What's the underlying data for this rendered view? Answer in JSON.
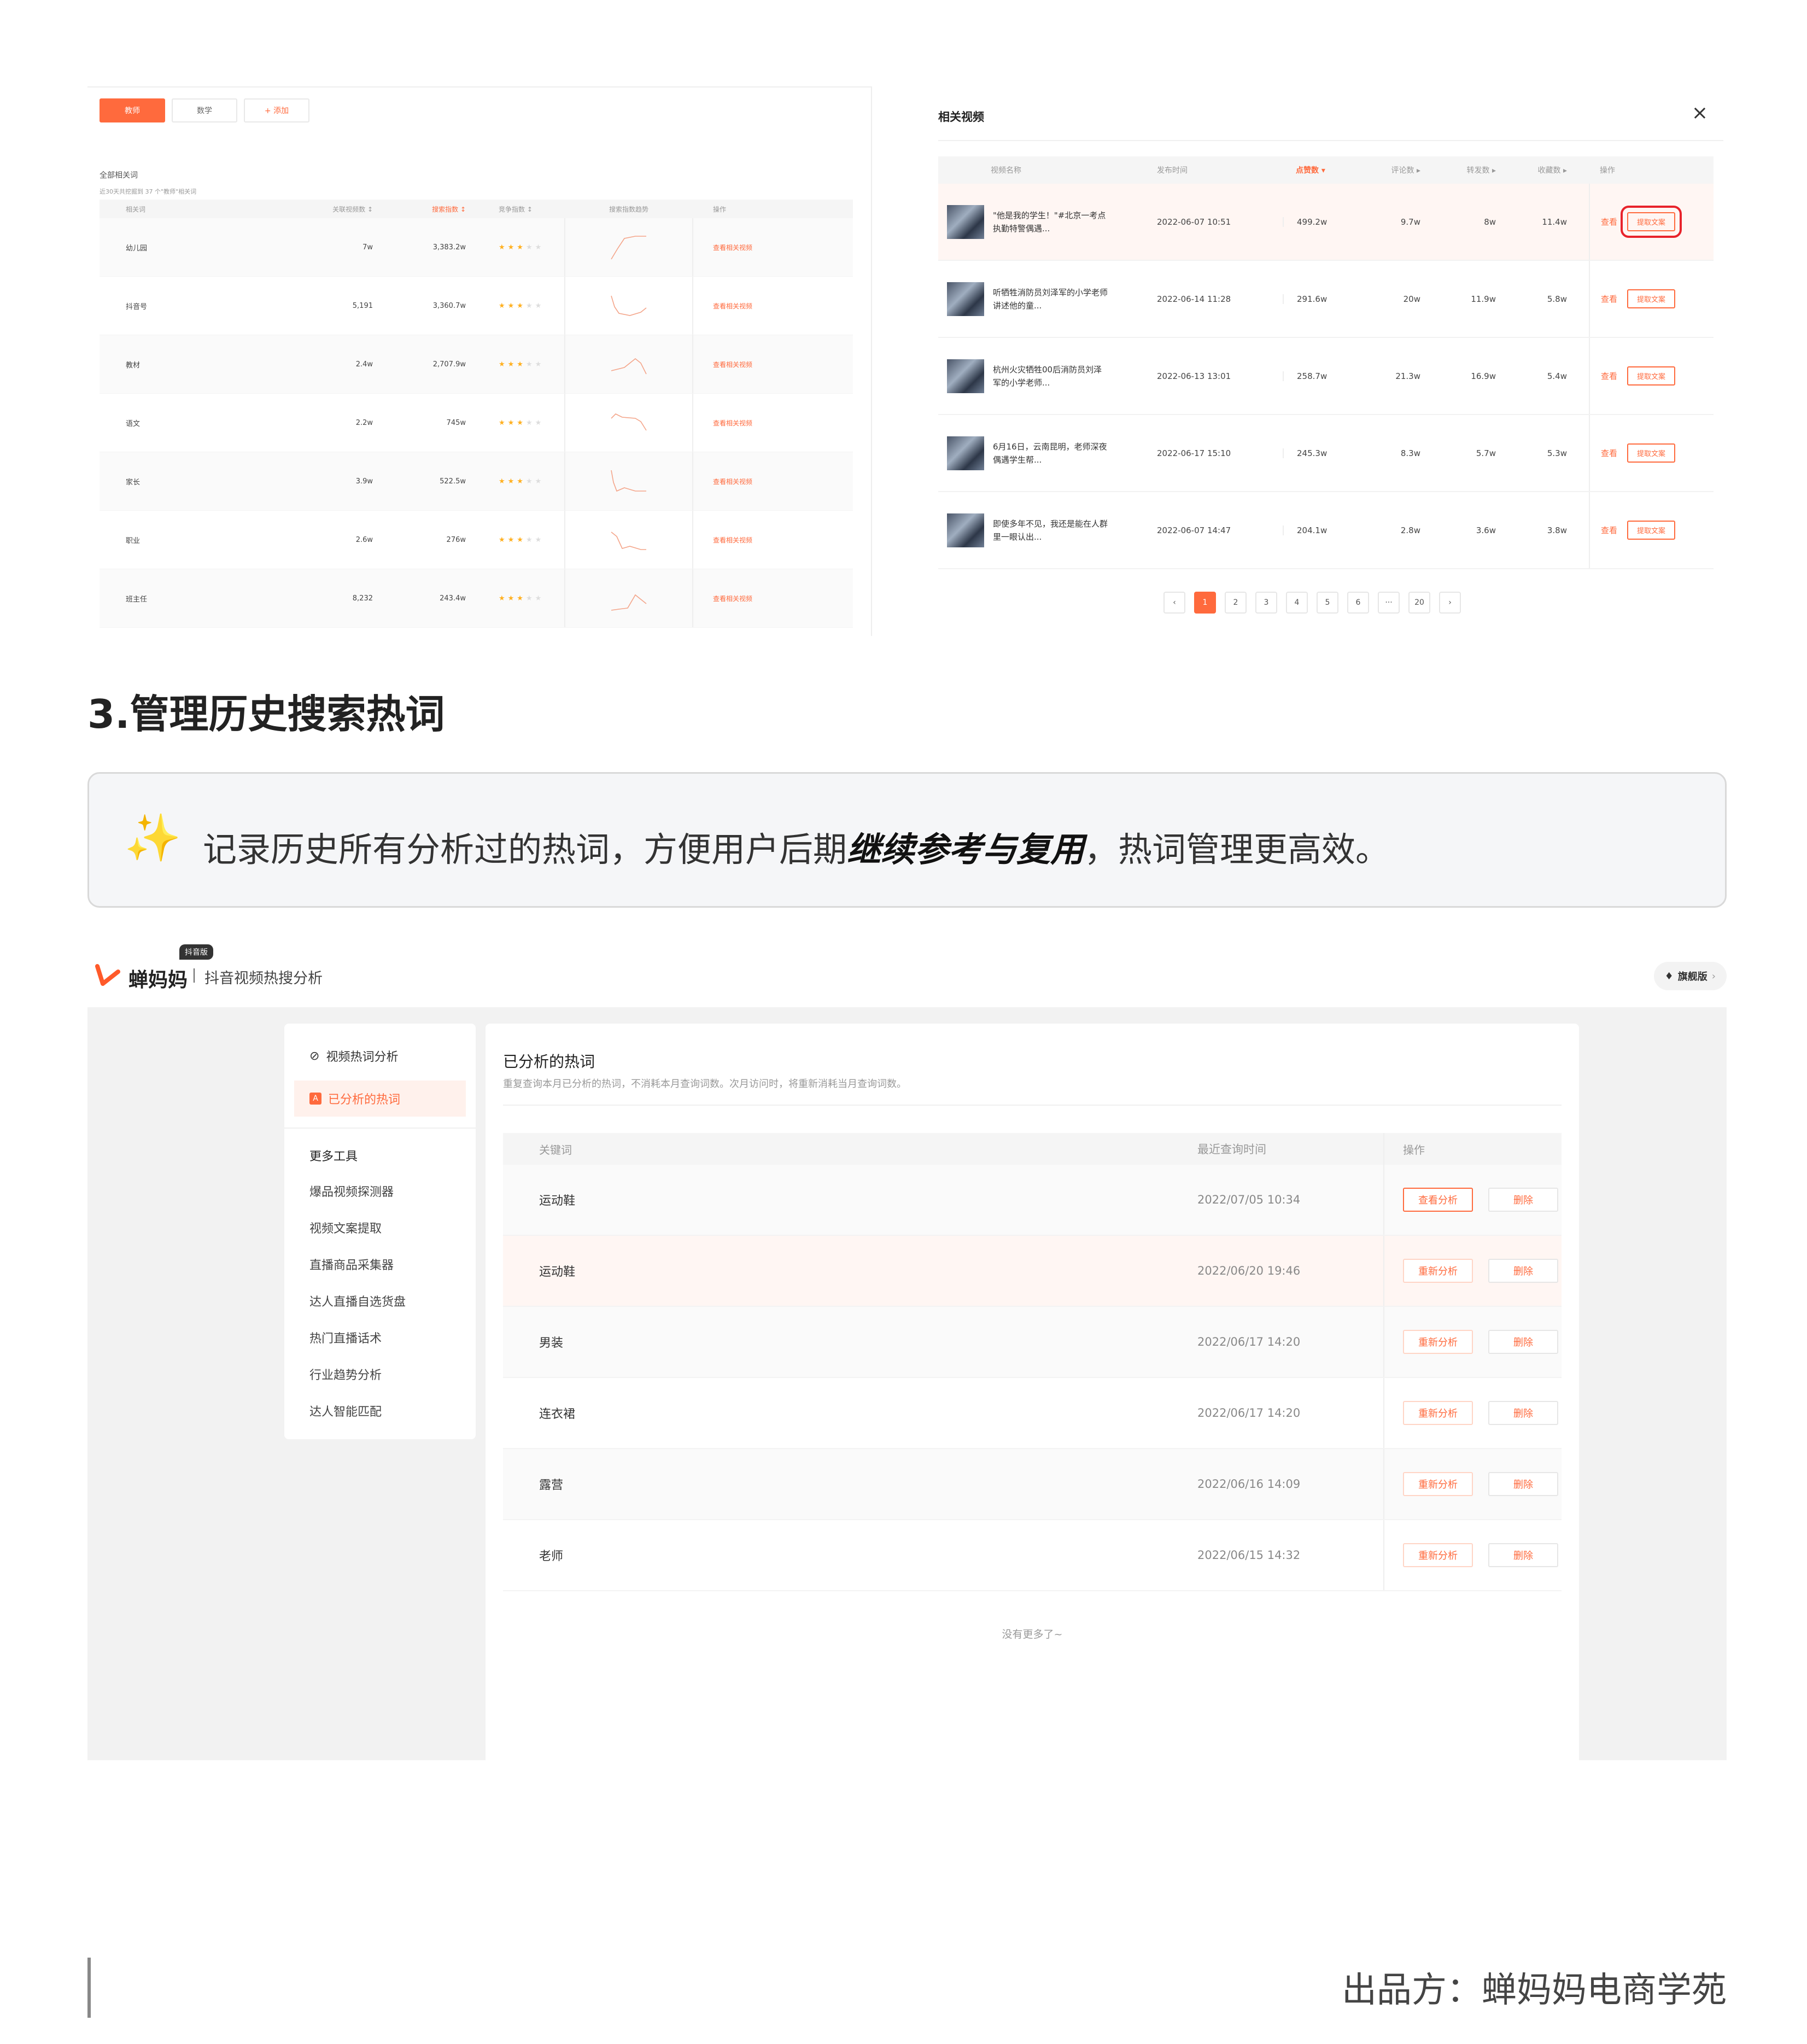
{
  "top_left": {
    "tags": [
      {
        "label": "教师",
        "active": true
      },
      {
        "label": "数学",
        "active": false
      },
      {
        "label": "+ 添加",
        "active": false
      }
    ],
    "section_title": "全部相关词",
    "section_sub": "近30天共挖掘到 37 个\"教师\"相关词",
    "headers": [
      "相关词",
      "关联视频数 ↕",
      "搜索指数 ↕",
      "竞争指数 ↕",
      "搜索指数趋势",
      "操作"
    ],
    "rows": [
      {
        "word": "幼儿园",
        "videos": "7w",
        "index": "3,383.2w",
        "stars": "★★★",
        "off": "★★",
        "action": "查看相关视频"
      },
      {
        "word": "抖音号",
        "videos": "5,191",
        "index": "3,360.7w",
        "stars": "★★★",
        "off": "★★",
        "action": "查看相关视频"
      },
      {
        "word": "教材",
        "videos": "2.4w",
        "index": "2,707.9w",
        "stars": "★★★",
        "off": "★★",
        "action": "查看相关视频"
      },
      {
        "word": "语文",
        "videos": "2.2w",
        "index": "745w",
        "stars": "★★★",
        "off": "★★",
        "action": "查看相关视频"
      },
      {
        "word": "家长",
        "videos": "3.9w",
        "index": "522.5w",
        "stars": "★★★",
        "off": "★★",
        "action": "查看相关视频"
      },
      {
        "word": "职业",
        "videos": "2.6w",
        "index": "276w",
        "stars": "★★★",
        "off": "★★",
        "action": "查看相关视频"
      },
      {
        "word": "班主任",
        "videos": "8,232",
        "index": "243.4w",
        "stars": "★★★",
        "off": "★★",
        "action": "查看相关视频"
      }
    ]
  },
  "top_right": {
    "title": "相关视频",
    "close": "×",
    "headers": [
      "视频名称",
      "发布时间",
      "点赞数 ▾",
      "评论数 ▸",
      "转发数 ▸",
      "收藏数 ▸",
      "操作"
    ],
    "rows": [
      {
        "name": "\"他是我的学生！\"#北京一考点执勤特警偶遇...",
        "time": "2022-06-07 10:51",
        "likes": "499.2w",
        "comments": "9.7w",
        "shares": "8w",
        "favs": "11.4w",
        "look": "查看",
        "extract": "提取文案"
      },
      {
        "name": "听牺牲消防员刘泽军的小学老师讲述他的童...",
        "time": "2022-06-14 11:28",
        "likes": "291.6w",
        "comments": "20w",
        "shares": "11.9w",
        "favs": "5.8w",
        "look": "查看",
        "extract": "提取文案"
      },
      {
        "name": "杭州火灾牺牲00后消防员刘泽军的小学老师...",
        "time": "2022-06-13 13:01",
        "likes": "258.7w",
        "comments": "21.3w",
        "shares": "16.9w",
        "favs": "5.4w",
        "look": "查看",
        "extract": "提取文案"
      },
      {
        "name": "6月16日，云南昆明，老师深夜偶遇学生帮...",
        "time": "2022-06-17 15:10",
        "likes": "245.3w",
        "comments": "8.3w",
        "shares": "5.7w",
        "favs": "5.3w",
        "look": "查看",
        "extract": "提取文案"
      },
      {
        "name": "即使多年不见，我还是能在人群里一眼认出...",
        "time": "2022-06-07 14:47",
        "likes": "204.1w",
        "comments": "2.8w",
        "shares": "3.6w",
        "favs": "3.8w",
        "look": "查看",
        "extract": "提取文案"
      }
    ],
    "pager": [
      "‹",
      "1",
      "2",
      "3",
      "4",
      "5",
      "6",
      "···",
      "20",
      "›"
    ]
  },
  "section3": {
    "heading": "3.管理历史搜索热词",
    "callout_pre": "记录历史所有分析过的热词，方便用户后期",
    "callout_bold": "继续参考与复用",
    "callout_post": "，热词管理更高效。"
  },
  "app": {
    "brand": "蝉妈妈",
    "badge": "抖音版",
    "subtitle": "抖音视频热搜分析",
    "flagship": "旗舰版",
    "sidebar": {
      "item1": "视频热词分析",
      "item2": "已分析的热词",
      "more_tools": "更多工具",
      "tools": [
        "爆品视频探测器",
        "视频文案提取",
        "直播商品采集器",
        "达人直播自选货盘",
        "热门直播话术",
        "行业趋势分析",
        "达人智能匹配"
      ]
    },
    "panel": {
      "title": "已分析的热词",
      "subtitle": "重复查询本月已分析的热词，不消耗本月查询词数。次月访问时，将重新消耗当月查询词数。",
      "headers": [
        "关键词",
        "最近查询时间",
        "操作"
      ],
      "rows": [
        {
          "keyword": "运动鞋",
          "time": "2022/07/05 10:34",
          "action": "查看分析",
          "del": "删除"
        },
        {
          "keyword": "运动鞋",
          "time": "2022/06/20 19:46",
          "action": "重新分析",
          "del": "删除"
        },
        {
          "keyword": "男装",
          "time": "2022/06/17 14:20",
          "action": "重新分析",
          "del": "删除"
        },
        {
          "keyword": "连衣裙",
          "time": "2022/06/17 14:20",
          "action": "重新分析",
          "del": "删除"
        },
        {
          "keyword": "露营",
          "time": "2022/06/16 14:09",
          "action": "重新分析",
          "del": "删除"
        },
        {
          "keyword": "老师",
          "time": "2022/06/15 14:32",
          "action": "重新分析",
          "del": "删除"
        }
      ],
      "no_more": "没有更多了~"
    }
  },
  "footer": "出品方：蝉妈妈电商学苑",
  "colors": {
    "accent": "#ff6a3d",
    "highlight_box": "#e8232b"
  }
}
